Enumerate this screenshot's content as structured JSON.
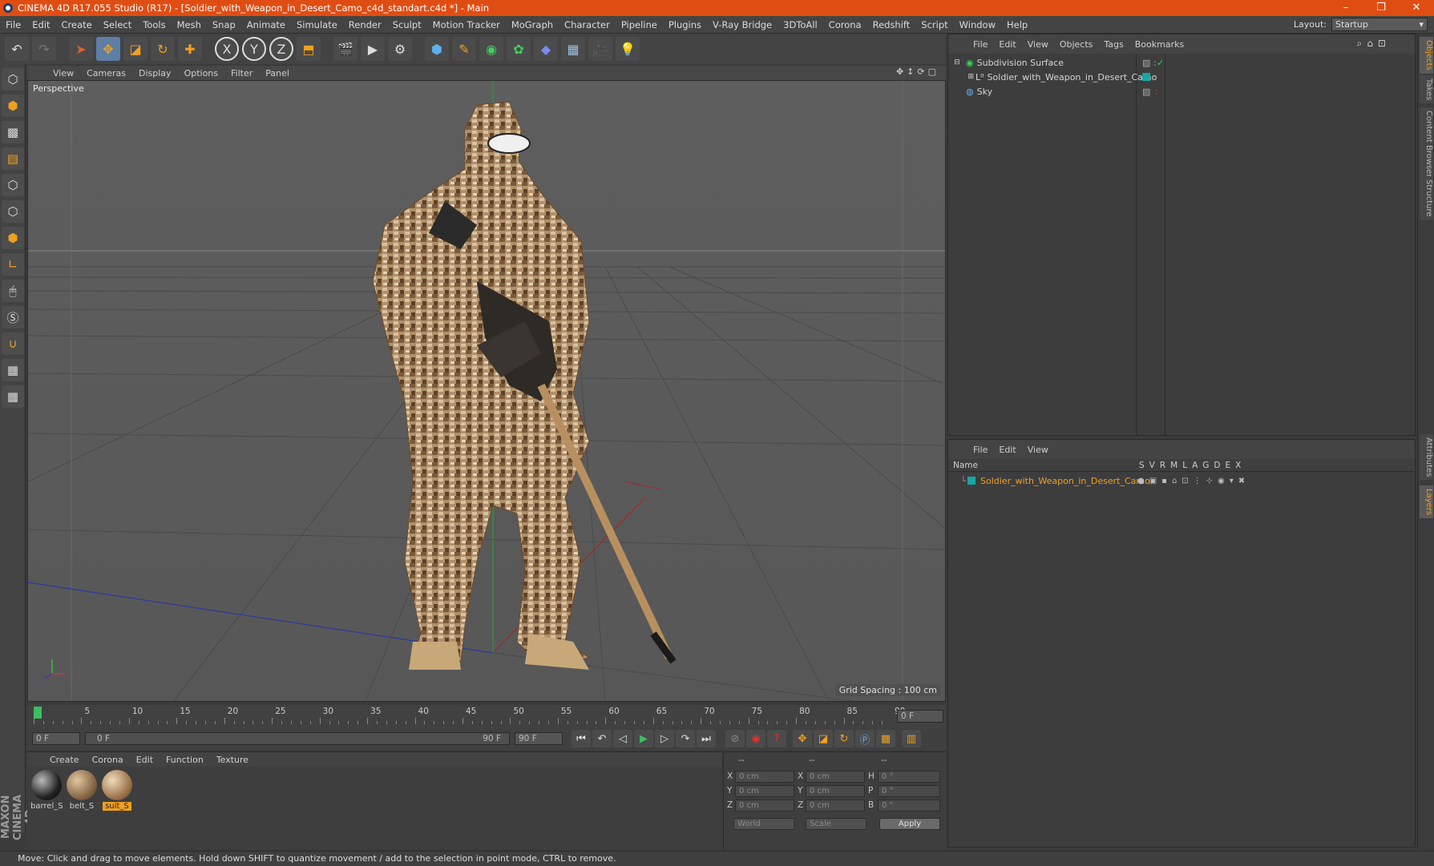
{
  "window": {
    "title": "CINEMA 4D R17.055 Studio (R17) - [Soldier_with_Weapon_in_Desert_Camo_c4d_standart.c4d *] - Main",
    "buttons": [
      "–",
      "❐",
      "✕"
    ]
  },
  "menu": [
    "File",
    "Edit",
    "Create",
    "Select",
    "Tools",
    "Mesh",
    "Snap",
    "Animate",
    "Simulate",
    "Render",
    "Sculpt",
    "Motion Tracker",
    "MoGraph",
    "Character",
    "Pipeline",
    "Plugins",
    "V-Ray Bridge",
    "3DToAll",
    "Corona",
    "Redshift",
    "Script",
    "Window",
    "Help"
  ],
  "layout": {
    "label": "Layout:",
    "value": "Startup"
  },
  "toolbar_icons": [
    "undo-icon",
    "redo-icon",
    "select-arrow-icon",
    "move-icon",
    "scale-icon",
    "rotate-icon",
    "add-object-icon",
    "x-axis-icon",
    "y-axis-icon",
    "z-axis-icon",
    "coordinate-system-icon",
    "render-view-icon",
    "render-picture-viewer-icon",
    "render-settings-icon",
    "cube-primitive-icon",
    "spline-pen-icon",
    "generator-icon",
    "mograph-cloner-icon",
    "deformer-icon",
    "floor-icon",
    "camera-icon",
    "light-icon"
  ],
  "viewport": {
    "menu": [
      "View",
      "Cameras",
      "Display",
      "Options",
      "Filter",
      "Panel"
    ],
    "label": "Perspective",
    "grid_spacing": "Grid Spacing : 100 cm"
  },
  "timeline": {
    "ticks": [
      "0",
      "5",
      "10",
      "15",
      "20",
      "25",
      "30",
      "35",
      "40",
      "45",
      "50",
      "55",
      "60",
      "65",
      "70",
      "75",
      "80",
      "85",
      "90"
    ],
    "current": "0 F",
    "start": "0 F",
    "range_start": "0 F",
    "range_end": "90 F",
    "end": "90 F"
  },
  "materials": {
    "menu": [
      "Create",
      "Corona",
      "Edit",
      "Function",
      "Texture"
    ],
    "items": [
      {
        "name": "barrel_S",
        "selected": false
      },
      {
        "name": "belt_S",
        "selected": false
      },
      {
        "name": "suit_S",
        "selected": true
      }
    ]
  },
  "coordinates": {
    "headers": [
      "--",
      "--",
      "--"
    ],
    "rows": [
      {
        "l1": "X",
        "v1": "0 cm",
        "l2": "X",
        "v2": "0 cm",
        "l3": "H",
        "v3": "0 °"
      },
      {
        "l1": "Y",
        "v1": "0 cm",
        "l2": "Y",
        "v2": "0 cm",
        "l3": "P",
        "v3": "0 °"
      },
      {
        "l1": "Z",
        "v1": "0 cm",
        "l2": "Z",
        "v2": "0 cm",
        "l3": "B",
        "v3": "0 °"
      }
    ],
    "mode": "World",
    "size_mode": "Scale",
    "apply": "Apply"
  },
  "objects": {
    "menu": [
      "File",
      "Edit",
      "View",
      "Objects",
      "Tags",
      "Bookmarks"
    ],
    "items": [
      {
        "name": "Subdivision Surface"
      },
      {
        "name": "Soldier_with_Weapon_in_Desert_Camo"
      },
      {
        "name": "Sky"
      }
    ]
  },
  "layers": {
    "menu": [
      "File",
      "Edit",
      "View"
    ],
    "header_name": "Name",
    "columns": [
      "S",
      "V",
      "R",
      "M",
      "L",
      "A",
      "G",
      "D",
      "E",
      "X"
    ],
    "items": [
      {
        "name": "Soldier_with_Weapon_in_Desert_Camo",
        "color": "#1aa6a6"
      }
    ]
  },
  "side_tabs": [
    "Objects",
    "Takes",
    "Content Browser",
    "Structure",
    "Attributes",
    "Layers"
  ],
  "status": "Move: Click and drag to move elements. Hold down SHIFT to quantize movement / add to the selection in point mode, CTRL to remove.",
  "brand": "MAXON CINEMA 4D",
  "colors": {
    "accent": "#e04d12",
    "highlight": "#f0a020",
    "selection": "#5f7ea6"
  }
}
